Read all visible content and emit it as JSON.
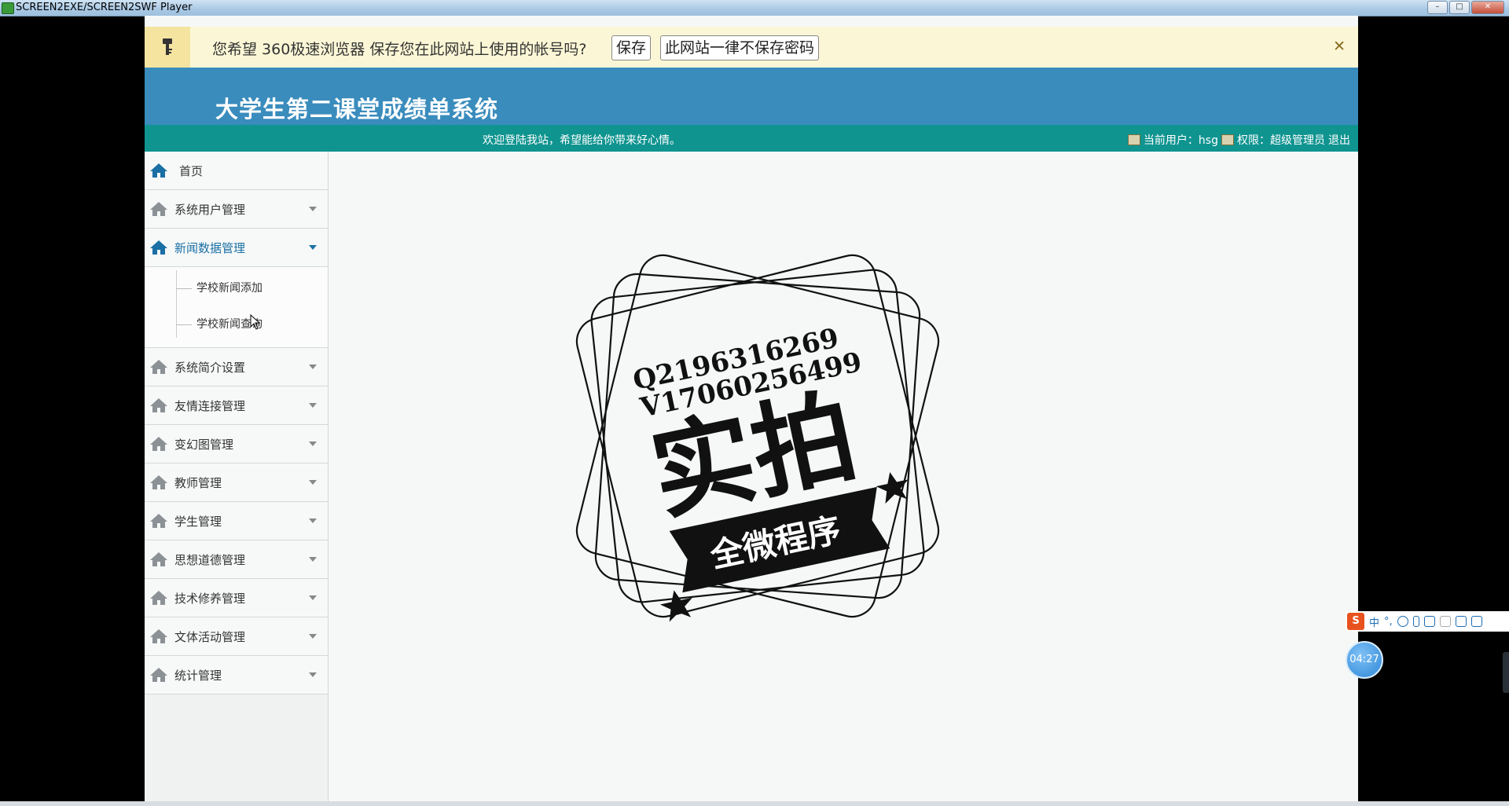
{
  "player": {
    "title": "SCREEN2EXE/SCREEN2SWF Player",
    "buttons": [
      "–",
      "□",
      "✕"
    ]
  },
  "save_password_bar": {
    "icon": "key-icon",
    "message": "您希望 360极速浏览器 保存您在此网站上使用的帐号吗?",
    "save_label": "保存",
    "never_label": "此网站一律不保存密码",
    "close_label": "✕"
  },
  "header": {
    "system_title": "大学生第二课堂成绩单系统"
  },
  "infobar": {
    "welcome": "欢迎登陆我站，希望能给你带来好心情。",
    "current_user_label": "当前用户：hsg",
    "permission_label": "权限：超级管理员",
    "logout_label": "退出"
  },
  "sidebar": {
    "home": "首页",
    "items": [
      {
        "label": "系统用户管理"
      },
      {
        "label": "新闻数据管理",
        "expanded": true,
        "sub": [
          "学校新闻添加",
          "学校新闻查询"
        ]
      },
      {
        "label": "系统简介设置"
      },
      {
        "label": "友情连接管理"
      },
      {
        "label": "变幻图管理"
      },
      {
        "label": "教师管理"
      },
      {
        "label": "学生管理"
      },
      {
        "label": "思想道德管理"
      },
      {
        "label": "技术修养管理"
      },
      {
        "label": "文体活动管理"
      },
      {
        "label": "统计管理"
      }
    ]
  },
  "watermark": {
    "line1": "Q2196316269",
    "line2": "V17060256499",
    "big_text": "实拍",
    "ribbon_text": "全微程序"
  },
  "ime": {
    "logo": "S",
    "mode": "中",
    "punct": "°,"
  },
  "timer": "04:27",
  "colors": {
    "header_blue": "#3a8cbd",
    "infobar_teal": "#0f9490",
    "active_menu": "#1a6fa5"
  }
}
